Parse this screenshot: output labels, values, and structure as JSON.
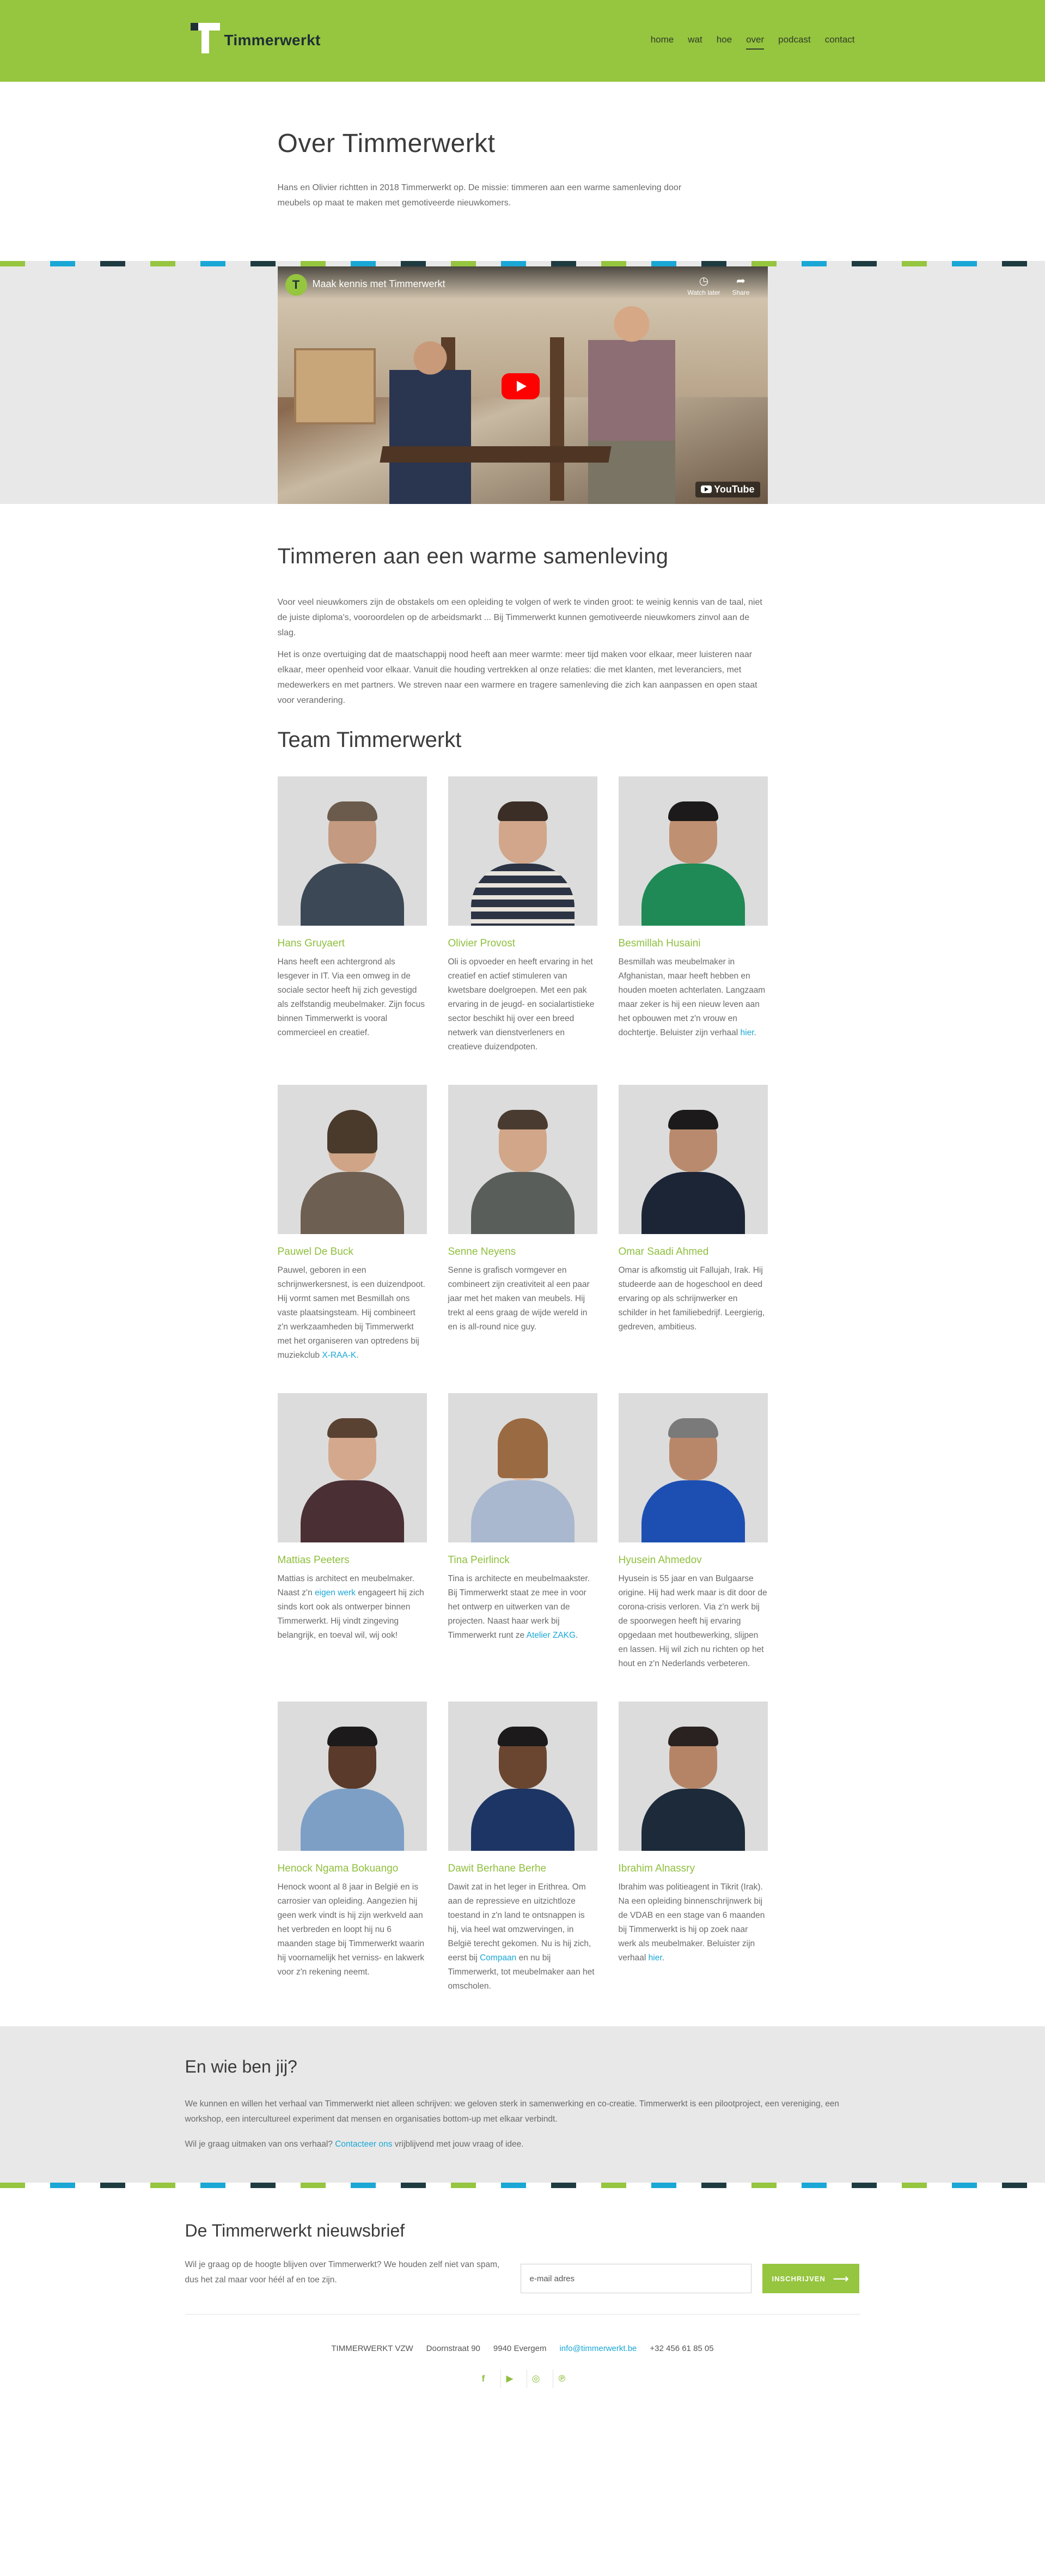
{
  "header": {
    "logo_letter": "T",
    "brand": "Timmerwerkt",
    "nav": [
      {
        "label": "home"
      },
      {
        "label": "wat"
      },
      {
        "label": "hoe"
      },
      {
        "label": "over"
      },
      {
        "label": "podcast"
      },
      {
        "label": "contact"
      }
    ],
    "active_nav": "over"
  },
  "intro": {
    "title": "Over Timmerwerkt",
    "text": "Hans en Olivier richtten in 2018 Timmerwerkt op. De missie: timmeren aan een warme samenleving door meubels op maat te maken met gemotiveerde nieuwkomers."
  },
  "video": {
    "channel_letter": "T",
    "title": "Maak kennis met Timmerwerkt",
    "watch_later": "Watch later",
    "share": "Share",
    "platform": "YouTube"
  },
  "mission": {
    "title": "Timmeren aan een warme samenleving",
    "p1": "Voor veel nieuwkomers zijn de obstakels om een opleiding te volgen of werk te vinden groot: te weinig kennis van de taal, niet de juiste diploma's, vooroordelen op de arbeidsmarkt ... Bij Timmerwerkt kunnen gemotiveerde nieuwkomers zinvol aan de slag.",
    "p2": "Het is onze overtuiging dat de maatschappij nood heeft aan meer warmte: meer tijd maken voor elkaar, meer luisteren naar elkaar, meer openheid voor elkaar. Vanuit die houding vertrekken al onze relaties: die met klanten, met leveranciers, met medewerkers en met partners. We streven naar een warmere en tragere samenleving die zich kan aanpassen en open staat voor verandering."
  },
  "team": {
    "title": "Team Timmerwerkt",
    "members": [
      {
        "name": "Hans Gruyaert",
        "bio": "Hans heeft een achtergrond als lesgever in IT. Via een omweg in de sociale sector heeft hij zich gevestigd als zelfstandig meubelmaker. Zijn focus binnen Timmerwerkt is vooral commercieel en creatief."
      },
      {
        "name": "Olivier Provost",
        "bio": "Oli is opvoeder en heeft ervaring in het creatief en actief stimuleren van kwetsbare doelgroepen. Met een pak ervaring in de jeugd- en socialartistieke sector beschikt hij over een breed netwerk van dienstverleners en creatieve duizendpoten."
      },
      {
        "name": "Besmillah Husaini",
        "bio_before": "Besmillah was meubelmaker in Afghanistan, maar heeft hebben en houden moeten achterlaten. Langzaam maar zeker is hij een nieuw leven aan het opbouwen met z'n vrouw en dochtertje. Beluister zijn verhaal ",
        "link": "hier",
        "bio_after": "."
      },
      {
        "name": "Pauwel De Buck",
        "bio_before": "Pauwel, geboren in een schrijnwerkersnest, is een duizendpoot. Hij vormt samen met Besmillah ons vaste plaatsingsteam. Hij combineert z'n werkzaamheden bij Timmerwerkt met het organiseren van optredens bij muziekclub ",
        "link": "X-RAA-K",
        "bio_after": "."
      },
      {
        "name": "Senne Neyens",
        "bio": "Senne is grafisch vormgever en combineert zijn creativiteit al een paar jaar met het maken van meubels. Hij trekt al eens graag de wijde wereld in en is all-round nice guy."
      },
      {
        "name": "Omar Saadi Ahmed",
        "bio": "Omar is afkomstig uit Fallujah, Irak. Hij studeerde aan de hogeschool en deed ervaring op als schrijnwerker en schilder in het familiebedrijf. Leergierig, gedreven, ambitieus."
      },
      {
        "name": "Mattias Peeters",
        "bio_before": "Mattias is architect en meubelmaker. Naast z'n ",
        "link": "eigen werk",
        "bio_after": " engageert hij zich sinds kort ook als ontwerper binnen Timmerwerkt. Hij vindt zingeving belangrijk, en toeval wil, wij ook!"
      },
      {
        "name": "Tina Peirlinck",
        "bio_before": "Tina is architecte en meubelmaakster. Bij Timmerwerkt staat ze mee in voor het ontwerp en uitwerken van de projecten. Naast haar werk bij Timmerwerkt runt ze ",
        "link": "Atelier ZAKG",
        "bio_after": "."
      },
      {
        "name": "Hyusein Ahmedov",
        "bio": "Hyusein is 55 jaar en van Bulgaarse origine. Hij had werk maar is dit door de corona-crisis verloren. Via z'n werk bij de spoorwegen heeft hij ervaring opgedaan met houtbewerking, slijpen en lassen. Hij wil zich nu richten op het hout en z'n Nederlands verbeteren."
      },
      {
        "name": "Henock Ngama Bokuango",
        "bio": "Henock woont al 8 jaar in België en is carrosier van opleiding. Aangezien hij geen werk vindt is hij zijn werkveld aan het verbreden en loopt hij nu 6 maanden stage bij Timmerwerkt waarin hij voornamelijk het verniss- en lakwerk voor z'n rekening neemt."
      },
      {
        "name": "Dawit Berhane Berhe",
        "bio_before": "Dawit zat in het leger in Erithrea. Om aan de repressieve en uitzichtloze toestand in z'n land te ontsnappen is hij, via heel wat omzwervingen, in België terecht gekomen. Nu is hij zich, eerst bij ",
        "link": "Compaan",
        "bio_after": " en nu bij Timmerwerkt, tot meubelmaker aan het omscholen."
      },
      {
        "name": "Ibrahim Alnassry",
        "bio_before": "Ibrahim was politieagent in Tikrit (Irak). Na een opleiding binnenschrijnwerk bij de VDAB en een stage van 6 maanden bij Timmerwerkt is hij op zoek naar werk als meubelmaker. Beluister zijn verhaal ",
        "link": "hier",
        "bio_after": "."
      }
    ]
  },
  "who": {
    "title": "En wie ben jij?",
    "p1": "We kunnen en willen het verhaal van Timmerwerkt niet alleen schrijven: we geloven sterk in samenwerking en co-creatie. Timmerwerkt is een pilootproject, een vereniging, een workshop, een intercultureel experiment dat mensen en organisaties bottom-up met elkaar verbindt.",
    "p2_before": "Wil je graag uitmaken van ons verhaal? ",
    "p2_link": "Contacteer ons",
    "p2_after": " vrijblijvend met jouw vraag of idee."
  },
  "newsletter": {
    "title": "De Timmerwerkt nieuwsbrief",
    "text": "Wil je graag op de hoogte blijven over Timmerwerkt? We houden zelf niet van spam, dus het zal maar voor héél af en toe zijn.",
    "placeholder": "e-mail adres",
    "button": "INSCHRIJVEN",
    "button_arrow": "⟶"
  },
  "footer": {
    "org": "TIMMERWERKT VZW",
    "street": "Doornstraat 90",
    "city": "9940 Evergem",
    "email": "info@timmerwerkt.be",
    "phone": "+32 456 61 85 05",
    "socials": [
      {
        "icon": "facebook-icon",
        "glyph": "f"
      },
      {
        "icon": "youtube-icon",
        "glyph": "▶"
      },
      {
        "icon": "instagram-icon",
        "glyph": "◎"
      },
      {
        "icon": "pinterest-icon",
        "glyph": "℗"
      }
    ]
  },
  "colors": {
    "brand_green": "#96c53f",
    "dark": "#1e2f35",
    "link_blue": "#1aa7d6",
    "band_gray": "#e8e8e8"
  }
}
